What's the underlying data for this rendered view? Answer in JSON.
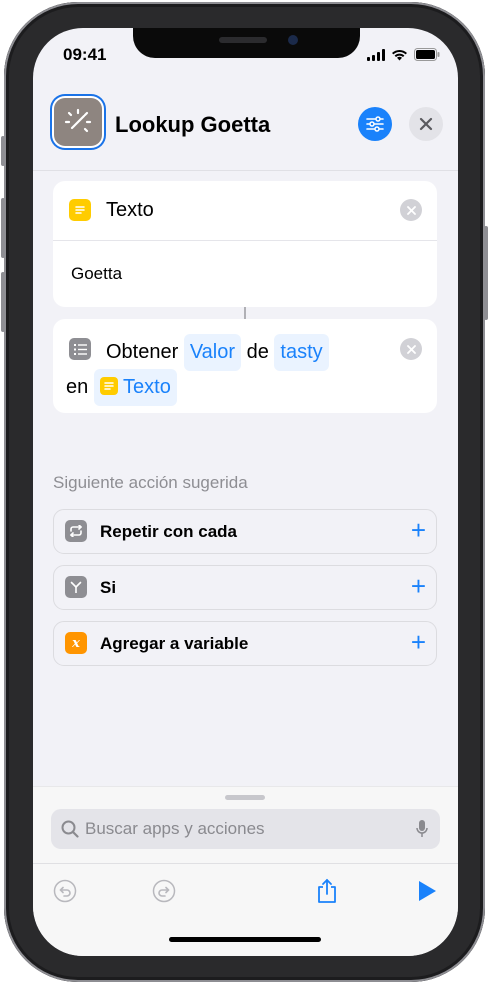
{
  "status_bar": {
    "time": "09:41"
  },
  "header": {
    "title": "Lookup Goetta",
    "app_icon": "magic-wand-icon",
    "settings_icon": "sliders-icon",
    "close_icon": "close-icon"
  },
  "actions": [
    {
      "icon": "text-note-icon",
      "title": "Texto",
      "content": "Goetta"
    },
    {
      "icon": "list-icon",
      "verb": "Obtener",
      "param1": "Valor",
      "word_de": "de",
      "param2": "tasty",
      "word_en": "en",
      "var_icon": "text-note-icon",
      "var_label": "Texto"
    }
  ],
  "suggestions": {
    "label": "Siguiente acción sugerida",
    "items": [
      {
        "label": "Repetir con cada",
        "icon": "repeat-icon",
        "icon_color": "#8e8e93"
      },
      {
        "label": "Si",
        "icon": "branch-icon",
        "icon_color": "#8e8e93"
      },
      {
        "label": "Agregar a variable",
        "icon": "variable-x-icon",
        "icon_color": "#ff9500"
      }
    ]
  },
  "bottom": {
    "search_placeholder": "Buscar apps y acciones",
    "toolbar": [
      "undo-icon",
      "redo-icon",
      "share-icon",
      "play-icon"
    ]
  },
  "colors": {
    "accent": "#1a82fb",
    "text_action": "#ffcc00",
    "background": "#f2f2f7"
  }
}
